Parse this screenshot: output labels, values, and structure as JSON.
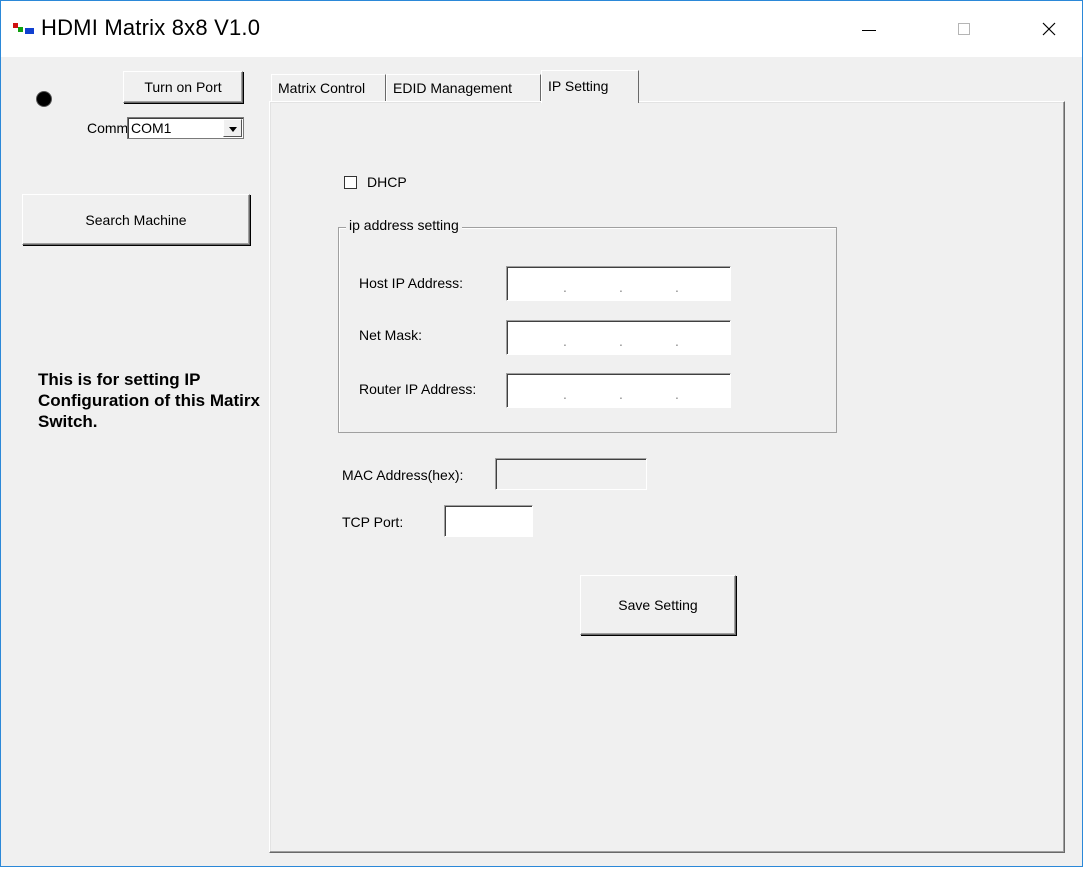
{
  "window": {
    "title": "HDMI Matrix 8x8 V1.0",
    "controls": {
      "minimize": "—",
      "maximize": "□",
      "close": "✕"
    },
    "accent_color": "#2b88d8"
  },
  "sidebar": {
    "turn_on_port_label": "Turn on Port",
    "comm_label": "Comm:",
    "comm_value": "COM1",
    "search_machine_label": "Search Machine",
    "info_text": "This is for setting IP Configuration of this Matirx Switch."
  },
  "tabs": [
    {
      "label": "Matrix Control",
      "active": false
    },
    {
      "label": "EDID Management",
      "active": false
    },
    {
      "label": "IP Setting",
      "active": true
    }
  ],
  "ip_setting": {
    "dhcp_label": "DHCP",
    "dhcp_checked": false,
    "group_title": "ip address setting",
    "host_ip_label": "Host IP Address:",
    "net_mask_label": "Net Mask:",
    "router_ip_label": "Router IP Address:",
    "ip_dots": ".",
    "mac_label": "MAC Address(hex):",
    "tcp_port_label": "TCP Port:",
    "save_label": "Save Setting"
  }
}
